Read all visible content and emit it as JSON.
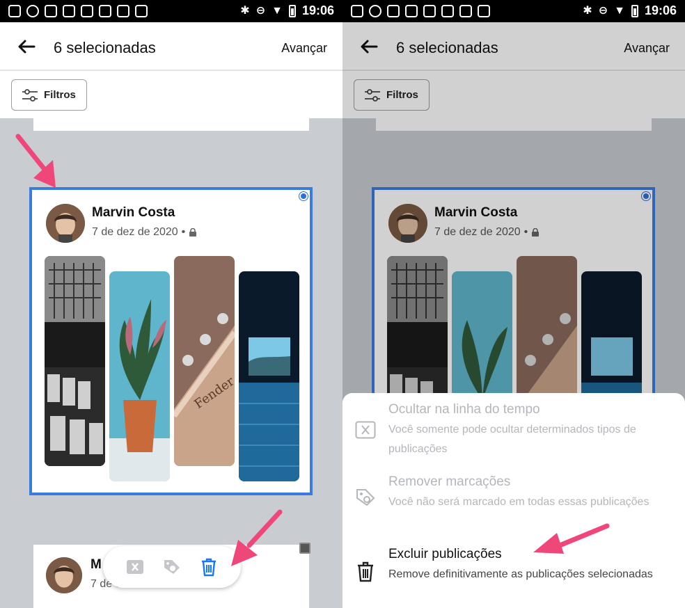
{
  "status_bar": {
    "time": "19:06"
  },
  "header": {
    "title": "6 selecionadas",
    "next_label": "Avançar"
  },
  "filters": {
    "label": "Filtros"
  },
  "post": {
    "author": "Marvin Costa",
    "date": "7 de dez de 2020",
    "separator": "•"
  },
  "post_2": {
    "author_partial": "M",
    "date_partial": "7 de dez de 2020"
  },
  "action_sheet": {
    "items": [
      {
        "title": "Ocultar na linha do tempo",
        "description": "Você somente pode ocultar determinados tipos de publicações",
        "enabled": false
      },
      {
        "title": "Remover marcações",
        "description": "Você não será marcado em todas essas publicações",
        "enabled": false
      },
      {
        "title": "Excluir publicações",
        "description": "Remove definitivamente as publicações selecionadas",
        "enabled": true
      }
    ]
  },
  "colors": {
    "selection_blue": "#3b7be0",
    "trash_blue": "#1877f2",
    "arrow_pink": "#f0477a"
  }
}
